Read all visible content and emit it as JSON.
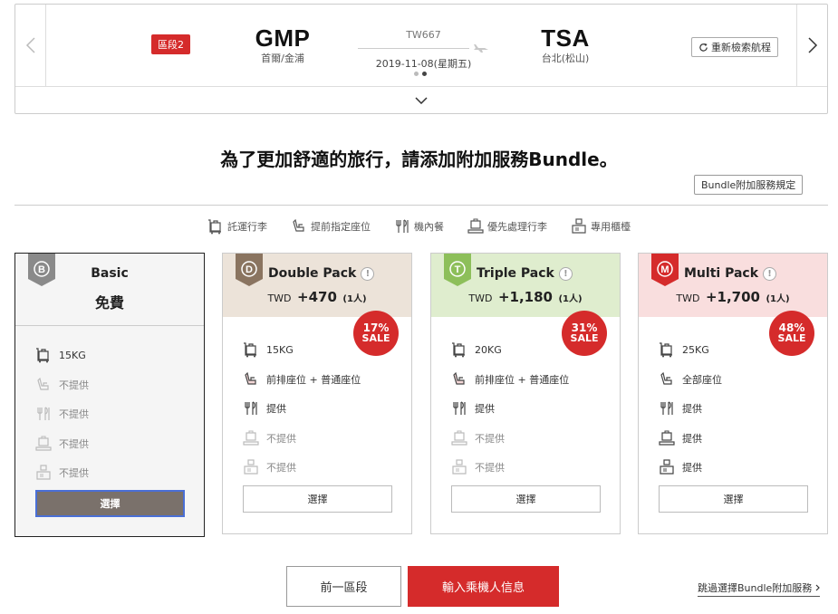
{
  "flight": {
    "segment_badge": "區段2",
    "origin_code": "GMP",
    "origin_city": "首爾/金浦",
    "flight_no": "TW667",
    "date": "2019-11-08(星期五)",
    "dest_code": "TSA",
    "dest_city": "台北(松山)",
    "research_label": "重新檢索航程"
  },
  "page": {
    "title": "為了更加舒適的旅行，請添加附加服務Bundle。",
    "rules_label": "Bundle附加服務規定"
  },
  "legend": [
    {
      "icon": "baggage-icon",
      "label": "託運行李"
    },
    {
      "icon": "seat-icon",
      "label": "提前指定座位"
    },
    {
      "icon": "meal-icon",
      "label": "機內餐"
    },
    {
      "icon": "priority-baggage-icon",
      "label": "優先處理行李"
    },
    {
      "icon": "counter-icon",
      "label": "專用櫃檯"
    }
  ],
  "bundles": {
    "basic": {
      "badge": "B",
      "name": "Basic",
      "price_label": "免費",
      "features": [
        "15KG",
        "不提供",
        "不提供",
        "不提供",
        "不提供"
      ],
      "select_label": "選擇"
    },
    "double": {
      "badge": "D",
      "name": "Double Pack",
      "currency": "TWD",
      "price": "+470",
      "per": "(1人)",
      "sale_pct": "17%",
      "sale_word": "SALE",
      "features": [
        "15KG",
        "前排座位 + 普通座位",
        "提供",
        "不提供",
        "不提供"
      ],
      "select_label": "選擇"
    },
    "triple": {
      "badge": "T",
      "name": "Triple Pack",
      "currency": "TWD",
      "price": "+1,180",
      "per": "(1人)",
      "sale_pct": "31%",
      "sale_word": "SALE",
      "features": [
        "20KG",
        "前排座位 + 普通座位",
        "提供",
        "不提供",
        "不提供"
      ],
      "select_label": "選擇"
    },
    "multi": {
      "badge": "M",
      "name": "Multi Pack",
      "currency": "TWD",
      "price": "+1,700",
      "per": "(1人)",
      "sale_pct": "48%",
      "sale_word": "SALE",
      "features": [
        "25KG",
        "全部座位",
        "提供",
        "提供",
        "提供"
      ],
      "select_label": "選擇"
    }
  },
  "actions": {
    "prev_label": "前一區段",
    "next_label": "輸入乘機人信息",
    "skip_label": "跳過選擇Bundle附加服務"
  },
  "colors": {
    "accent_red": "#d52b2b",
    "double_bg": "#ece3d9",
    "triple_bg": "#dfedce",
    "multi_bg": "#f9dede",
    "basic_badge": "#8a8a8a",
    "double_badge": "#8a7460",
    "triple_badge": "#8dbf5a",
    "multi_badge": "#d52b2b"
  }
}
